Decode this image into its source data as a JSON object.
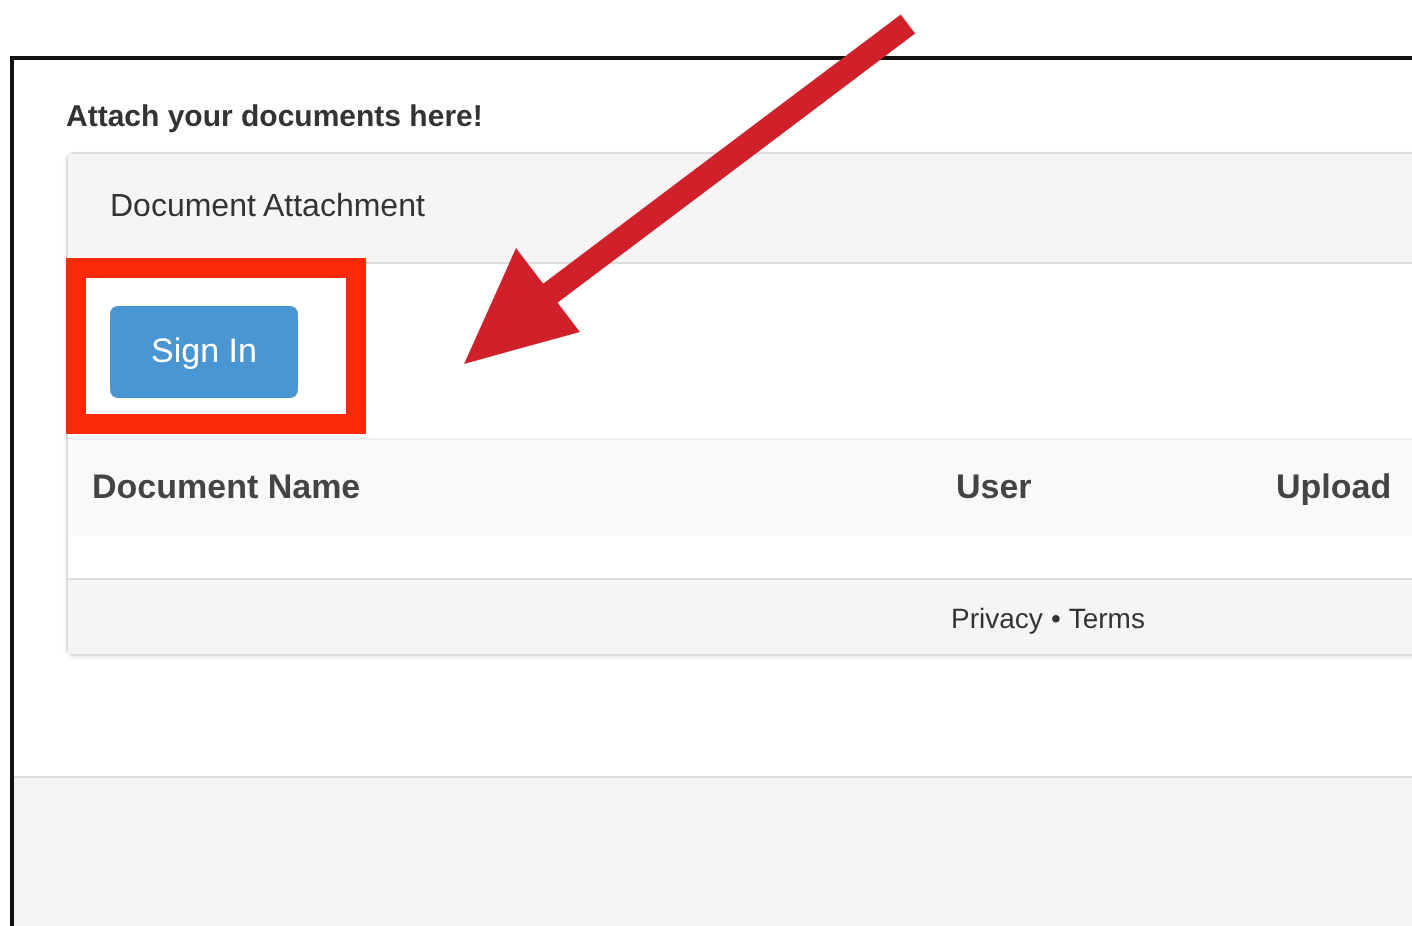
{
  "heading": "Attach your documents here!",
  "panel": {
    "title": "Document Attachment",
    "button": "Sign In",
    "highlighted": true
  },
  "table": {
    "columns": [
      "Document Name",
      "User",
      "Upload"
    ]
  },
  "footer": {
    "links": [
      "Privacy",
      "Terms"
    ],
    "separator": "•"
  },
  "annotation": {
    "kind": "arrow"
  }
}
